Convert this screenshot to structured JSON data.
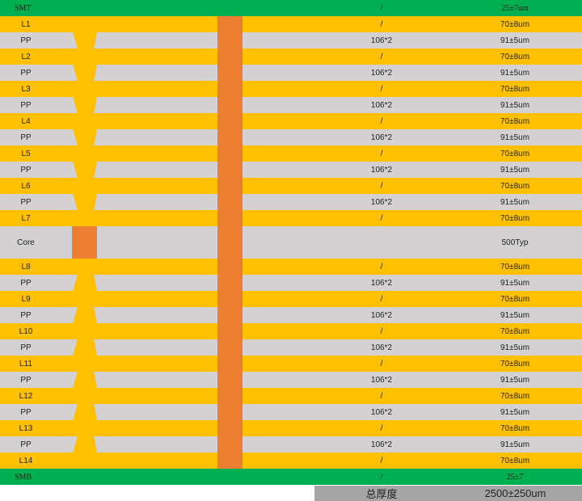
{
  "colors": {
    "copper": "#FFC000",
    "prepreg": "#D3D1D2",
    "solder_mask": "#00B050",
    "via_fill": "#ED7D31",
    "total_bar": "#A6A6A6"
  },
  "layers": [
    {
      "name": "SMT",
      "type": "mask",
      "material": "/",
      "thickness": "25±7um"
    },
    {
      "name": "L1",
      "type": "copper",
      "material": "/",
      "thickness": "70±8um"
    },
    {
      "name": "PP",
      "type": "pp",
      "material": "106*2",
      "thickness": "91±5um"
    },
    {
      "name": "L2",
      "type": "copper",
      "material": "/",
      "thickness": "70±8um"
    },
    {
      "name": "PP",
      "type": "pp",
      "material": "106*2",
      "thickness": "91±5um"
    },
    {
      "name": "L3",
      "type": "copper",
      "material": "/",
      "thickness": "70±8um"
    },
    {
      "name": "PP",
      "type": "pp",
      "material": "106*2",
      "thickness": "91±5um"
    },
    {
      "name": "L4",
      "type": "copper",
      "material": "/",
      "thickness": "70±8um"
    },
    {
      "name": "PP",
      "type": "pp",
      "material": "106*2",
      "thickness": "91±5um"
    },
    {
      "name": "L5",
      "type": "copper",
      "material": "/",
      "thickness": "70±8um"
    },
    {
      "name": "PP",
      "type": "pp",
      "material": "106*2",
      "thickness": "91±5um"
    },
    {
      "name": "L6",
      "type": "copper",
      "material": "/",
      "thickness": "70±8um"
    },
    {
      "name": "PP",
      "type": "pp",
      "material": "106*2",
      "thickness": "91±5um"
    },
    {
      "name": "L7",
      "type": "copper",
      "material": "/",
      "thickness": "70±8um"
    },
    {
      "name": "Core",
      "type": "core",
      "material": "",
      "thickness": "500Typ"
    },
    {
      "name": "L8",
      "type": "copper",
      "material": "/",
      "thickness": "70±8um"
    },
    {
      "name": "PP",
      "type": "pp",
      "material": "106*2",
      "thickness": "91±5um"
    },
    {
      "name": "L9",
      "type": "copper",
      "material": "/",
      "thickness": "70±8um"
    },
    {
      "name": "PP",
      "type": "pp",
      "material": "106*2",
      "thickness": "91±5um"
    },
    {
      "name": "L10",
      "type": "copper",
      "material": "/",
      "thickness": "70±8um"
    },
    {
      "name": "PP",
      "type": "pp",
      "material": "106*2",
      "thickness": "91±5um"
    },
    {
      "name": "L11",
      "type": "copper",
      "material": "/",
      "thickness": "70±8um"
    },
    {
      "name": "PP",
      "type": "pp",
      "material": "106*2",
      "thickness": "91±5um"
    },
    {
      "name": "L12",
      "type": "copper",
      "material": "/",
      "thickness": "70±8um"
    },
    {
      "name": "PP",
      "type": "pp",
      "material": "106*2",
      "thickness": "91±5um"
    },
    {
      "name": "L13",
      "type": "copper",
      "material": "/",
      "thickness": "70±8um"
    },
    {
      "name": "PP",
      "type": "pp",
      "material": "106*2",
      "thickness": "91±5um"
    },
    {
      "name": "L14",
      "type": "copper",
      "material": "/",
      "thickness": "70±8um"
    },
    {
      "name": "SMB",
      "type": "mask",
      "material": "/",
      "thickness": "25±7"
    }
  ],
  "total": {
    "label": "总厚度",
    "value": "2500±250um"
  }
}
